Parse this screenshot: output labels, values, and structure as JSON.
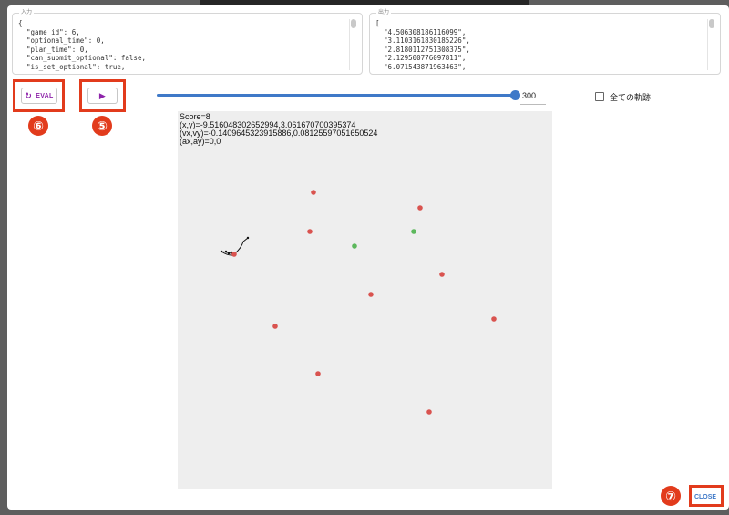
{
  "input_panel": {
    "label": "入力",
    "lines": [
      "{",
      "  \"game_id\": 6,",
      "  \"optional_time\": 0,",
      "  \"plan_time\": 0,",
      "  \"can_submit_optional\": false,",
      "  \"is_set_optional\": true,"
    ]
  },
  "output_panel": {
    "label": "出力",
    "lines": [
      "[",
      "  \"4.506308186116099\",",
      "  \"3.1103161830185226\",",
      "  \"2.8180112751308375\",",
      "  \"2.129500776097811\",",
      "  \"6.071543871963463\","
    ]
  },
  "toolbar": {
    "eval_label": "EVAL",
    "eval_icon": "refresh-icon",
    "play_icon": "play-icon",
    "slider_value": "300",
    "slider_fraction": 1.0,
    "show_all_label": "全ての軌跡",
    "show_all_checked": false
  },
  "annotations": {
    "eval_badge": "⑥",
    "play_badge": "⑤",
    "close_badge": "⑦"
  },
  "game_info": {
    "score": "Score=8",
    "position": "(x,y)=-9.516048302652994,3.061670700395374",
    "velocity": "(vx,vy)=-0.14096453239158​86,0.0812559705165052​4",
    "acceleration": "(ax,ay)=0,0"
  },
  "colors": {
    "accent": "#3f79c8",
    "highlight": "#e23b1c",
    "eval_text": "#8e24aa",
    "target_dot": "#d9534f",
    "reached_dot": "#5cb85c"
  },
  "footer": {
    "close_label": "CLOSE"
  }
}
